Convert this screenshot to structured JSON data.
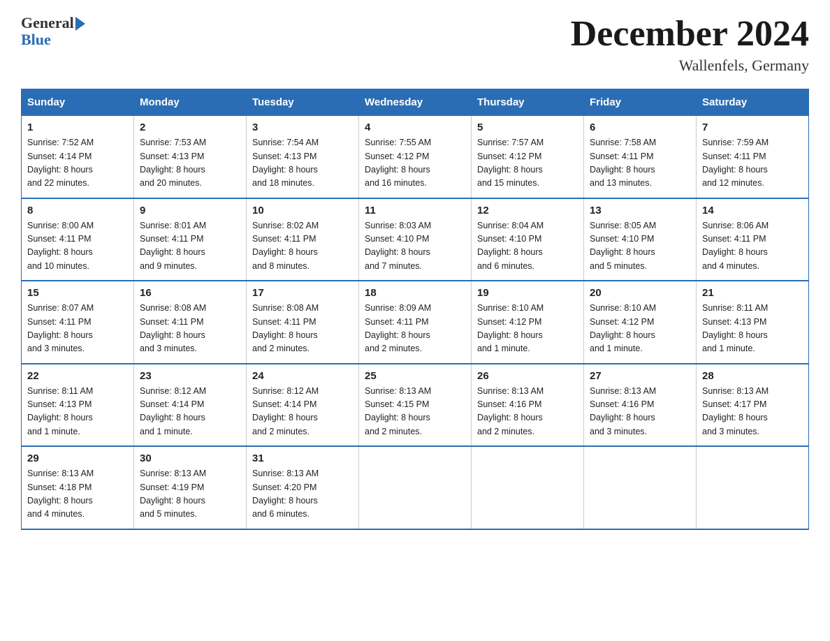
{
  "header": {
    "logo_general": "General",
    "logo_blue": "Blue",
    "month_title": "December 2024",
    "location": "Wallenfels, Germany"
  },
  "days_of_week": [
    "Sunday",
    "Monday",
    "Tuesday",
    "Wednesday",
    "Thursday",
    "Friday",
    "Saturday"
  ],
  "weeks": [
    [
      {
        "day": "1",
        "sunrise": "7:52 AM",
        "sunset": "4:14 PM",
        "daylight": "8 hours and 22 minutes."
      },
      {
        "day": "2",
        "sunrise": "7:53 AM",
        "sunset": "4:13 PM",
        "daylight": "8 hours and 20 minutes."
      },
      {
        "day": "3",
        "sunrise": "7:54 AM",
        "sunset": "4:13 PM",
        "daylight": "8 hours and 18 minutes."
      },
      {
        "day": "4",
        "sunrise": "7:55 AM",
        "sunset": "4:12 PM",
        "daylight": "8 hours and 16 minutes."
      },
      {
        "day": "5",
        "sunrise": "7:57 AM",
        "sunset": "4:12 PM",
        "daylight": "8 hours and 15 minutes."
      },
      {
        "day": "6",
        "sunrise": "7:58 AM",
        "sunset": "4:11 PM",
        "daylight": "8 hours and 13 minutes."
      },
      {
        "day": "7",
        "sunrise": "7:59 AM",
        "sunset": "4:11 PM",
        "daylight": "8 hours and 12 minutes."
      }
    ],
    [
      {
        "day": "8",
        "sunrise": "8:00 AM",
        "sunset": "4:11 PM",
        "daylight": "8 hours and 10 minutes."
      },
      {
        "day": "9",
        "sunrise": "8:01 AM",
        "sunset": "4:11 PM",
        "daylight": "8 hours and 9 minutes."
      },
      {
        "day": "10",
        "sunrise": "8:02 AM",
        "sunset": "4:11 PM",
        "daylight": "8 hours and 8 minutes."
      },
      {
        "day": "11",
        "sunrise": "8:03 AM",
        "sunset": "4:10 PM",
        "daylight": "8 hours and 7 minutes."
      },
      {
        "day": "12",
        "sunrise": "8:04 AM",
        "sunset": "4:10 PM",
        "daylight": "8 hours and 6 minutes."
      },
      {
        "day": "13",
        "sunrise": "8:05 AM",
        "sunset": "4:10 PM",
        "daylight": "8 hours and 5 minutes."
      },
      {
        "day": "14",
        "sunrise": "8:06 AM",
        "sunset": "4:11 PM",
        "daylight": "8 hours and 4 minutes."
      }
    ],
    [
      {
        "day": "15",
        "sunrise": "8:07 AM",
        "sunset": "4:11 PM",
        "daylight": "8 hours and 3 minutes."
      },
      {
        "day": "16",
        "sunrise": "8:08 AM",
        "sunset": "4:11 PM",
        "daylight": "8 hours and 3 minutes."
      },
      {
        "day": "17",
        "sunrise": "8:08 AM",
        "sunset": "4:11 PM",
        "daylight": "8 hours and 2 minutes."
      },
      {
        "day": "18",
        "sunrise": "8:09 AM",
        "sunset": "4:11 PM",
        "daylight": "8 hours and 2 minutes."
      },
      {
        "day": "19",
        "sunrise": "8:10 AM",
        "sunset": "4:12 PM",
        "daylight": "8 hours and 1 minute."
      },
      {
        "day": "20",
        "sunrise": "8:10 AM",
        "sunset": "4:12 PM",
        "daylight": "8 hours and 1 minute."
      },
      {
        "day": "21",
        "sunrise": "8:11 AM",
        "sunset": "4:13 PM",
        "daylight": "8 hours and 1 minute."
      }
    ],
    [
      {
        "day": "22",
        "sunrise": "8:11 AM",
        "sunset": "4:13 PM",
        "daylight": "8 hours and 1 minute."
      },
      {
        "day": "23",
        "sunrise": "8:12 AM",
        "sunset": "4:14 PM",
        "daylight": "8 hours and 1 minute."
      },
      {
        "day": "24",
        "sunrise": "8:12 AM",
        "sunset": "4:14 PM",
        "daylight": "8 hours and 2 minutes."
      },
      {
        "day": "25",
        "sunrise": "8:13 AM",
        "sunset": "4:15 PM",
        "daylight": "8 hours and 2 minutes."
      },
      {
        "day": "26",
        "sunrise": "8:13 AM",
        "sunset": "4:16 PM",
        "daylight": "8 hours and 2 minutes."
      },
      {
        "day": "27",
        "sunrise": "8:13 AM",
        "sunset": "4:16 PM",
        "daylight": "8 hours and 3 minutes."
      },
      {
        "day": "28",
        "sunrise": "8:13 AM",
        "sunset": "4:17 PM",
        "daylight": "8 hours and 3 minutes."
      }
    ],
    [
      {
        "day": "29",
        "sunrise": "8:13 AM",
        "sunset": "4:18 PM",
        "daylight": "8 hours and 4 minutes."
      },
      {
        "day": "30",
        "sunrise": "8:13 AM",
        "sunset": "4:19 PM",
        "daylight": "8 hours and 5 minutes."
      },
      {
        "day": "31",
        "sunrise": "8:13 AM",
        "sunset": "4:20 PM",
        "daylight": "8 hours and 6 minutes."
      },
      null,
      null,
      null,
      null
    ]
  ],
  "labels": {
    "sunrise": "Sunrise:",
    "sunset": "Sunset:",
    "daylight": "Daylight:"
  }
}
